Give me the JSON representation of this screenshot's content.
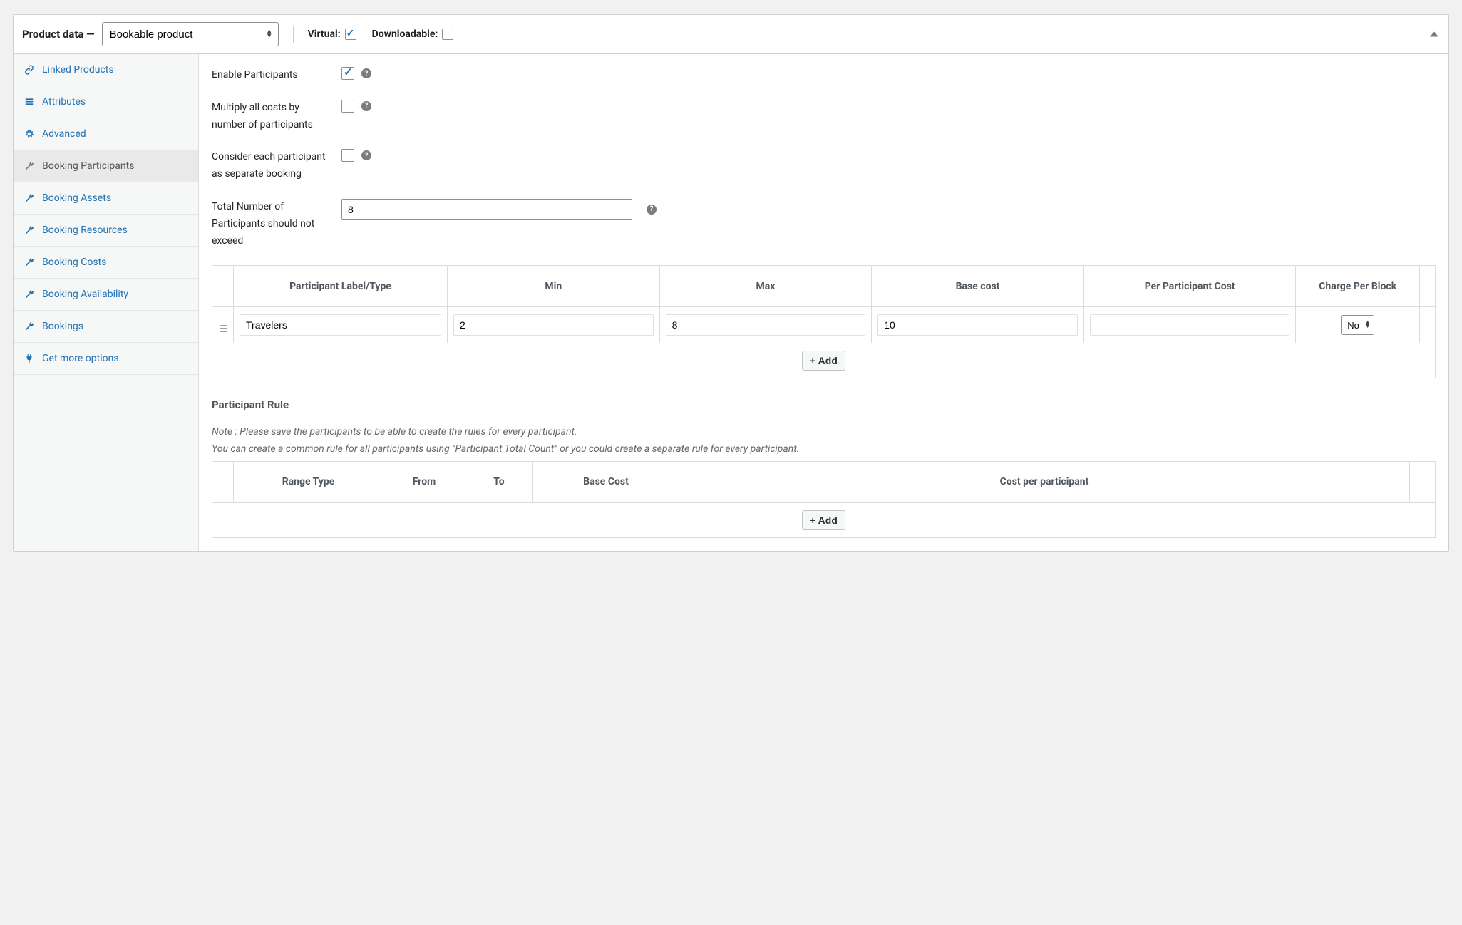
{
  "header": {
    "title": "Product data —",
    "product_type": "Bookable product",
    "virtual_label": "Virtual:",
    "virtual_checked": true,
    "downloadable_label": "Downloadable:",
    "downloadable_checked": false
  },
  "sidebar": {
    "items": [
      {
        "icon": "link",
        "label": "Linked Products",
        "active": false
      },
      {
        "icon": "list",
        "label": "Attributes",
        "active": false
      },
      {
        "icon": "gear",
        "label": "Advanced",
        "active": false
      },
      {
        "icon": "wrench",
        "label": "Booking Participants",
        "active": true
      },
      {
        "icon": "wrench",
        "label": "Booking Assets",
        "active": false
      },
      {
        "icon": "wrench",
        "label": "Booking Resources",
        "active": false
      },
      {
        "icon": "wrench",
        "label": "Booking Costs",
        "active": false
      },
      {
        "icon": "wrench",
        "label": "Booking Availability",
        "active": false
      },
      {
        "icon": "wrench",
        "label": "Bookings",
        "active": false
      },
      {
        "icon": "plug",
        "label": "Get more options",
        "active": false
      }
    ]
  },
  "form": {
    "enable_label": "Enable Participants",
    "enable_checked": true,
    "multiply_label": "Multiply all costs by number of participants",
    "multiply_checked": false,
    "separate_label": "Consider each participant as separate booking",
    "separate_checked": false,
    "max_label": "Total Number of Participants should not exceed",
    "max_value": "8"
  },
  "participants_table": {
    "headers": [
      "",
      "Participant Label/Type",
      "Min",
      "Max",
      "Base cost",
      "Per Participant Cost",
      "Charge Per Block",
      ""
    ],
    "rows": [
      {
        "label": "Travelers",
        "min": "2",
        "max": "8",
        "base": "10",
        "per": "",
        "charge": "No"
      }
    ],
    "add_label": "+ Add"
  },
  "rules": {
    "title": "Participant Rule",
    "note_line1": "Note : Please save the participants to be able to create the rules for every participant.",
    "note_line2": "You can create a common rule for all participants using \"Participant Total Count\" or you could create a separate rule for every participant.",
    "headers": [
      "",
      "Range Type",
      "From",
      "To",
      "Base Cost",
      "Cost per participant",
      ""
    ],
    "add_label": "+ Add"
  }
}
